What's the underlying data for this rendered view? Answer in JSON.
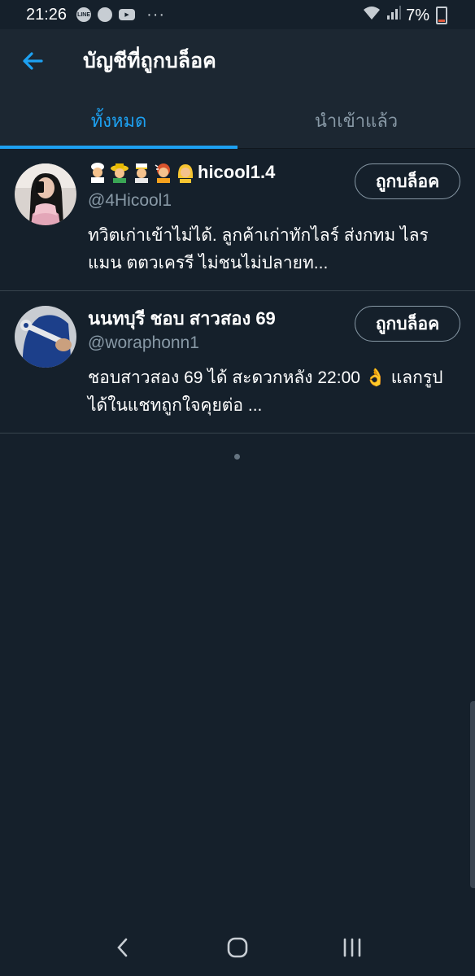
{
  "status_bar": {
    "time": "21:26",
    "battery": "7%",
    "app_icons": [
      "line-icon",
      "chrome-icon",
      "youtube-icon"
    ],
    "more_dots": "···"
  },
  "appbar": {
    "title": "บัญชีที่ถูกบล็อค"
  },
  "tabs": [
    {
      "label": "ทั้งหมด",
      "active": true
    },
    {
      "label": "นำเข้าแล้ว",
      "active": false
    }
  ],
  "accounts": [
    {
      "name": "hicool1.4",
      "emojis": [
        "cook-emoji",
        "farmer-emoji",
        "police-emoji",
        "hairdresser-emoji",
        "blond-person-emoji"
      ],
      "handle": "@4Hicool1",
      "bio": "ทวิตเก่าเข้าไม่ได้. ลูกค้าเก่าทักไลร์ ส่งกทม ไลรแมน ตตวเครรี ไม่ชนไม่ปลายท...",
      "button": "ถูกบล็อค"
    },
    {
      "name": "นนทบุรี ชอบ สาวสอง 69",
      "handle": "@woraphonn1",
      "bio": "ชอบสาวสอง 69 ได้ สะดวกหลัง 22:00 👌 แลกรูปได้ในแชทถูกใจคุยต่อ ...",
      "button": "ถูกบล็อค"
    }
  ],
  "colors": {
    "background": "#15202b",
    "header": "#1c2732",
    "accent": "#1da1f2",
    "secondary_text": "#8899a6"
  }
}
